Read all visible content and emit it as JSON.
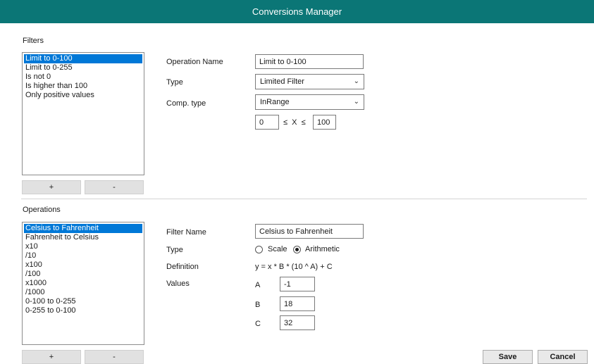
{
  "window": {
    "title": "Conversions Manager"
  },
  "filters": {
    "section_label": "Filters",
    "items": [
      "Limit to 0-100",
      "Limit to 0-255",
      "Is not 0",
      "Is higher than 100",
      "Only positive values"
    ],
    "add_label": "+",
    "remove_label": "-",
    "form": {
      "name_label": "Operation Name",
      "name_value": "Limit to 0-100",
      "type_label": "Type",
      "type_value": "Limited Filter",
      "comp_label": "Comp. type",
      "comp_value": "InRange",
      "range_min": "0",
      "range_expr": "≤  X  ≤",
      "range_max": "100"
    }
  },
  "operations": {
    "section_label": "Operations",
    "items": [
      "Celsius to Fahrenheit",
      "Fahrenheit to Celsius",
      "x10",
      "/10",
      "x100",
      "/100",
      "x1000",
      "/1000",
      "0-100 to 0-255",
      "0-255 to 0-100"
    ],
    "add_label": "+",
    "remove_label": "-",
    "form": {
      "name_label": "Filter Name",
      "name_value": "Celsius to Fahrenheit",
      "type_label": "Type",
      "type_options": [
        "Scale",
        "Arithmetic"
      ],
      "type_selected": "Arithmetic",
      "definition_label": "Definition",
      "definition_value": "y = x * B * (10 ^ A) + C",
      "values_label": "Values",
      "a_label": "A",
      "a_value": "-1",
      "b_label": "B",
      "b_value": "18",
      "c_label": "C",
      "c_value": "32"
    }
  },
  "footer": {
    "save_label": "Save",
    "cancel_label": "Cancel"
  }
}
